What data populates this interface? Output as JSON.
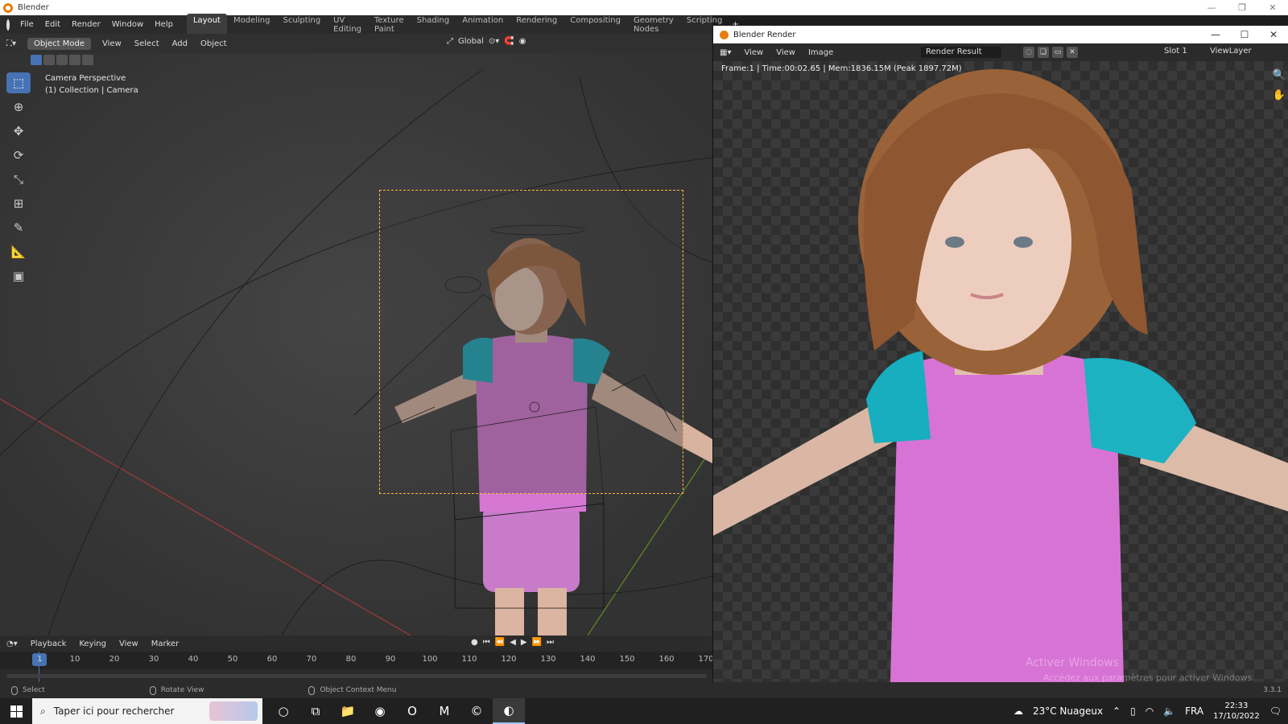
{
  "titlebar": {
    "title": "Blender",
    "minimize": "—",
    "restore": "❐",
    "close": "✕"
  },
  "topbar": {
    "menus": [
      "File",
      "Edit",
      "Render",
      "Window",
      "Help"
    ],
    "workspaces": [
      "Layout",
      "Modeling",
      "Sculpting",
      "UV Editing",
      "Texture Paint",
      "Shading",
      "Animation",
      "Rendering",
      "Compositing",
      "Geometry Nodes",
      "Scripting"
    ],
    "active_workspace": "Layout",
    "add_workspace": "+"
  },
  "viewport": {
    "mode": "Object Mode",
    "menus": [
      "View",
      "Select",
      "Add",
      "Object"
    ],
    "orientation": "Global",
    "info_line1": "Camera Perspective",
    "info_line2": "(1) Collection | Camera",
    "tools": [
      {
        "name": "select-box-tool",
        "icon": "⬚",
        "active": true
      },
      {
        "name": "cursor-tool",
        "icon": "⊕",
        "active": false
      },
      {
        "name": "move-tool",
        "icon": "✥",
        "active": false
      },
      {
        "name": "rotate-tool",
        "icon": "⟳",
        "active": false
      },
      {
        "name": "scale-tool",
        "icon": "⤡",
        "active": false
      },
      {
        "name": "transform-tool",
        "icon": "⊞",
        "active": false
      },
      {
        "name": "annotate-tool",
        "icon": "✎",
        "active": false
      },
      {
        "name": "measure-tool",
        "icon": "📐",
        "active": false
      },
      {
        "name": "add-cube-tool",
        "icon": "▣",
        "active": false
      }
    ]
  },
  "timeline": {
    "menus": [
      "Playback",
      "Keying",
      "View",
      "Marker"
    ],
    "current_frame": "1",
    "ticks": [
      "10",
      "20",
      "30",
      "40",
      "50",
      "60",
      "70",
      "80",
      "90",
      "100",
      "110",
      "120",
      "130",
      "140",
      "150",
      "160",
      "170"
    ],
    "controls": [
      "●",
      "⏮",
      "⏪",
      "◀",
      "▶",
      "⏩",
      "⏭"
    ]
  },
  "statusbar": {
    "select": "Select",
    "rotate": "Rotate View",
    "context": "Object Context Menu",
    "version": "3.3.1"
  },
  "render": {
    "window_title": "Blender Render",
    "menus": [
      "View",
      "View",
      "Image"
    ],
    "image_name": "Render Result",
    "slot": "Slot 1",
    "view_layer": "ViewLayer",
    "stats": "Frame:1 | Time:00:02.65 | Mem:1836.15M (Peak 1897.72M)",
    "watermark": "Activer Windows",
    "watermark_sub": "Accédez aux paramètres pour activer Windows."
  },
  "taskbar": {
    "search_placeholder": "Taper ici pour rechercher",
    "weather": "23°C  Nuageux",
    "language": "FRA",
    "time": "22:33",
    "date": "17/10/2022",
    "apps": [
      {
        "name": "cortana-icon",
        "icon": "○",
        "selected": false
      },
      {
        "name": "task-view-icon",
        "icon": "⧉",
        "selected": false
      },
      {
        "name": "file-explorer-icon",
        "icon": "📁",
        "selected": false
      },
      {
        "name": "chrome-icon",
        "icon": "◉",
        "selected": false
      },
      {
        "name": "opera-icon",
        "icon": "O",
        "selected": false
      },
      {
        "name": "maya-icon",
        "icon": "M",
        "selected": false
      },
      {
        "name": "c-app-icon",
        "icon": "©",
        "selected": false
      },
      {
        "name": "blender-icon",
        "icon": "◐",
        "selected": true
      }
    ]
  },
  "colors": {
    "accent": "#4772b3",
    "camera_frame": "#ffb347",
    "shirt": "#d46fd6",
    "sleeve": "#1fb3c4",
    "hair": "#8a5a32",
    "skin": "#e9c7b3"
  }
}
